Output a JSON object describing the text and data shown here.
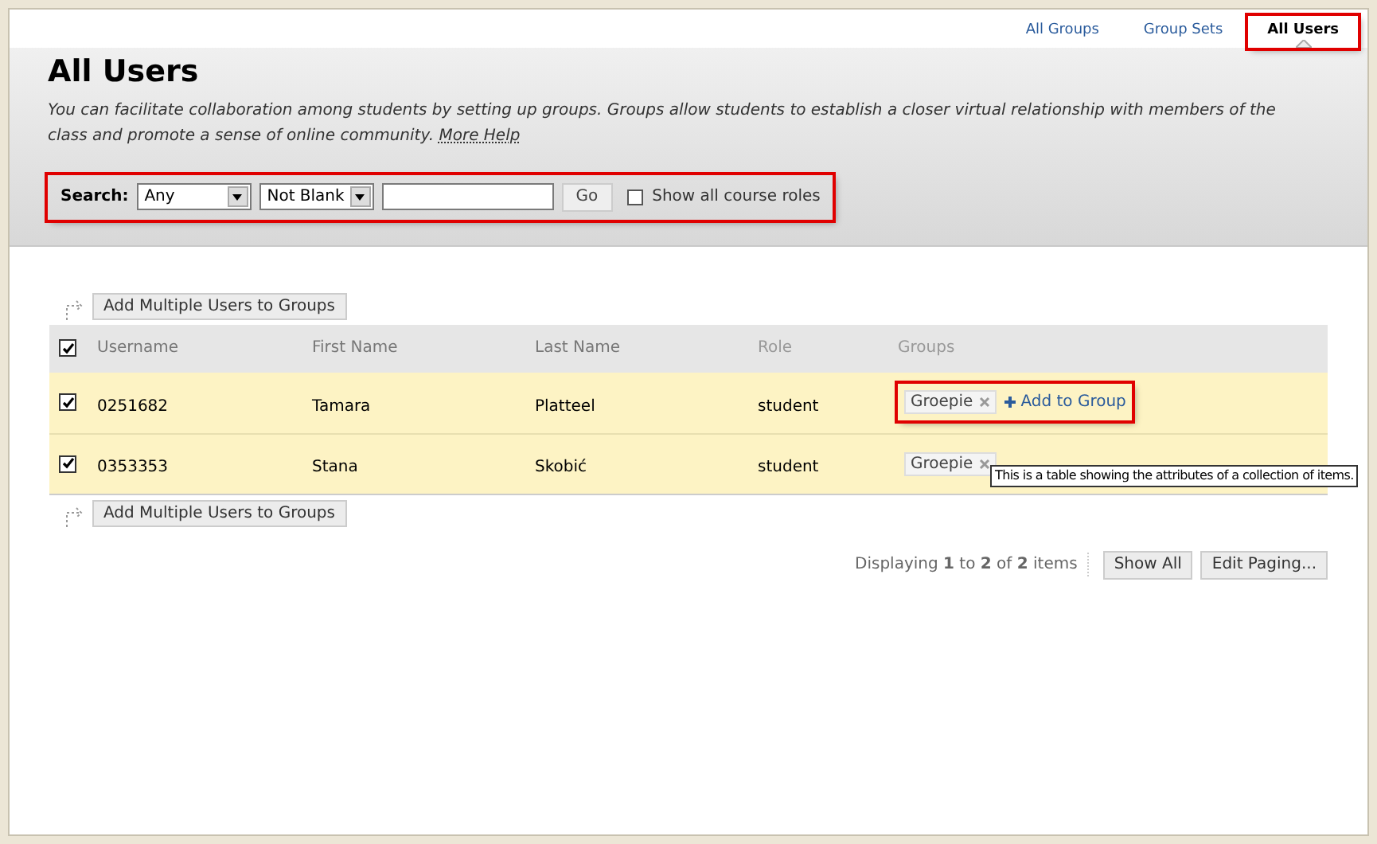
{
  "tabs": [
    {
      "label": "All Groups",
      "selected": false,
      "highlighted": false
    },
    {
      "label": "Group Sets",
      "selected": false,
      "highlighted": false
    },
    {
      "label": "All Users",
      "selected": true,
      "highlighted": true
    }
  ],
  "title": "All Users",
  "description": "You can facilitate collaboration among students by setting up groups. Groups allow students to establish a closer virtual relationship with members of the class and promote a sense of online community.",
  "help_link": "More Help",
  "search": {
    "label": "Search:",
    "highlighted": true,
    "field_select": "Any",
    "condition_select": "Not Blank",
    "go": "Go",
    "show_all_roles": {
      "label": "Show all course roles",
      "checked": false
    }
  },
  "add_multiple_button": "Add Multiple Users to Groups",
  "table": {
    "columns": [
      "Username",
      "First Name",
      "Last Name",
      "Role",
      "Groups"
    ],
    "all_checked": true,
    "rows": [
      {
        "checked": true,
        "cells": [
          "0251682",
          "Tamara",
          "Platteel",
          "student"
        ],
        "groups": [
          "Groepie"
        ],
        "add_to_group": "Add to Group",
        "highlighted": true
      },
      {
        "checked": true,
        "cells": [
          "0353353",
          "Stana",
          "Skobić",
          "student"
        ],
        "groups": [
          "Groepie"
        ],
        "tooltip": "This is a table showing the attributes of a collection of items.",
        "highlighted": false
      }
    ]
  },
  "add_multiple_button_bottom": "Add Multiple Users to Groups",
  "paging": {
    "summary": "Displaying **1** to **2** of **2** items",
    "buttons": [
      "Show All",
      "Edit Paging..."
    ]
  }
}
